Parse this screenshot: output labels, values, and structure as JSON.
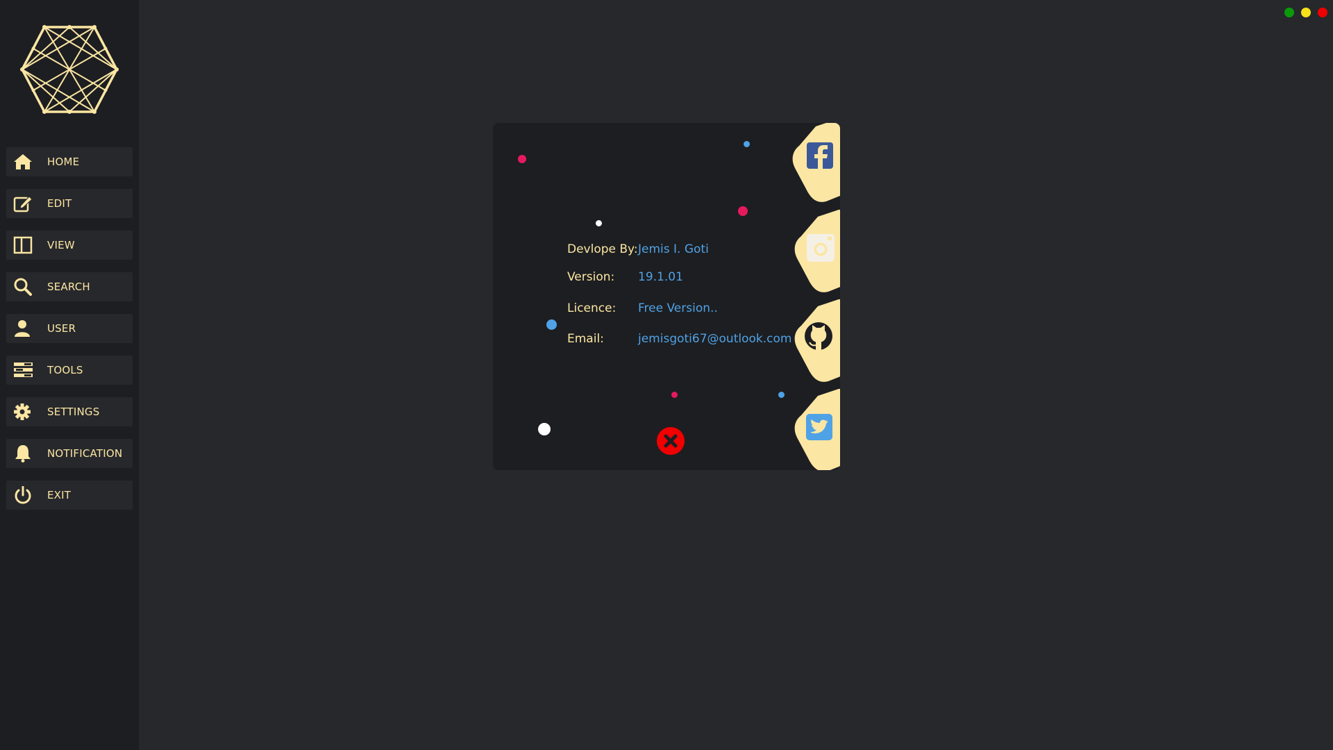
{
  "sidebar": {
    "logo_icon": "hexagon-network-logo",
    "items": [
      {
        "label": "HOME",
        "icon": "home-icon"
      },
      {
        "label": "EDIT",
        "icon": "edit-icon"
      },
      {
        "label": "VIEW",
        "icon": "view-columns-icon"
      },
      {
        "label": "SEARCH",
        "icon": "search-icon"
      },
      {
        "label": "USER",
        "icon": "user-icon"
      },
      {
        "label": "TOOLS",
        "icon": "tools-icon"
      },
      {
        "label": "SETTINGS",
        "icon": "gear-icon"
      },
      {
        "label": "NOTIFICATION",
        "icon": "bell-icon"
      },
      {
        "label": "EXIT",
        "icon": "power-icon"
      }
    ]
  },
  "window_controls": {
    "colors": [
      "#0a9a0a",
      "#f7e11a",
      "#f00000"
    ]
  },
  "about": {
    "developer_label": "Devlope By:",
    "developer_value": "Jemis I. Goti",
    "version_label": "Version:",
    "version_value": "19.1.01",
    "licence_label": "Licence:",
    "licence_value": "Free Version..",
    "email_label": "Email:",
    "email_value": "jemisgoti67@outlook.com",
    "social": [
      "facebook-icon",
      "instagram-icon",
      "github-icon",
      "twitter-icon"
    ],
    "close_icon": "close-icon"
  },
  "theme": {
    "accent": "#fbe6a3",
    "link": "#4fa2e6",
    "background": "#27282c",
    "panel": "#1d1e21"
  }
}
